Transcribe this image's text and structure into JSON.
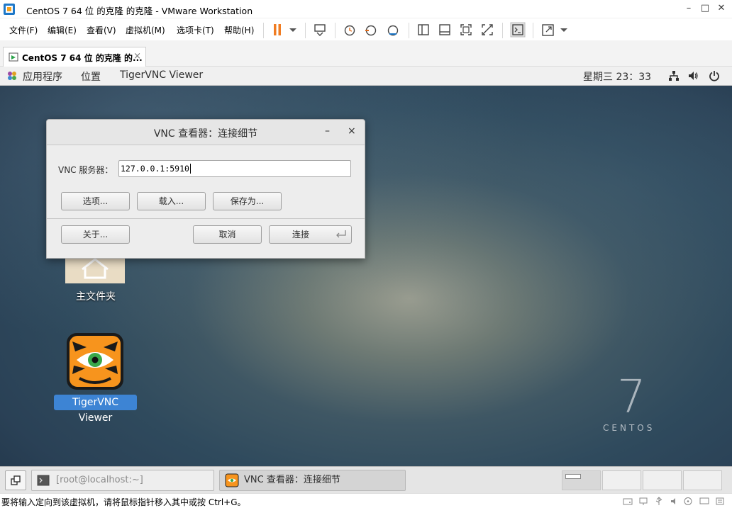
{
  "window": {
    "title": "CentOS 7 64 位 的克隆 的克隆 - VMware Workstation",
    "controls": [
      "–",
      "□",
      "✕"
    ]
  },
  "menu": [
    "文件(F)",
    "编辑(E)",
    "查看(V)",
    "虚拟机(M)",
    "选项卡(T)",
    "帮助(H)"
  ],
  "tab": {
    "label": "CentOS 7 64 位 的克隆 的...",
    "close": "×"
  },
  "gnome_panel": {
    "applications": "应用程序",
    "places": "位置",
    "active_app": "TigerVNC Viewer",
    "clock": "星期三 23：33"
  },
  "desktop": {
    "home_folder_label": "主文件夹",
    "tigervnc_label": "TigerVNC Viewer",
    "centos_number": "7",
    "centos_word": "CENTOS"
  },
  "dialog": {
    "title": "VNC 查看器：连接细节",
    "minimize": "–",
    "close": "×",
    "server_label": "VNC 服务器：",
    "server_value": "127.0.0.1:5910",
    "options_button": "选项...",
    "load_button": "载入...",
    "save_as_button": "保存为...",
    "about_button": "关于...",
    "cancel_button": "取消",
    "connect_button": "连接"
  },
  "taskbar": {
    "terminal_task": "[root@localhost:~]",
    "vnc_task": "VNC 查看器：连接细节"
  },
  "statusbar": {
    "message": "要将输入定向到该虚拟机，请将鼠标指针移入其中或按 Ctrl+G。"
  },
  "colors": {
    "selection_blue": "#3d84d4",
    "pause_orange": "#f07c22",
    "tiger_orange": "#f7941d"
  }
}
